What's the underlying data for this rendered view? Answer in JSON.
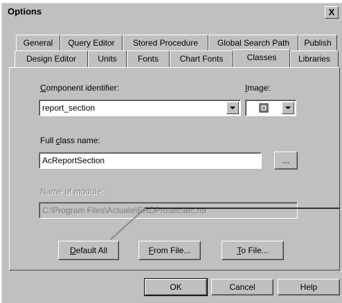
{
  "window": {
    "title": "Options",
    "close_label": "X"
  },
  "tabs_row1": [
    "General",
    "Query Editor",
    "Stored Procedure",
    "Global Search Path",
    "Publish"
  ],
  "tabs_row2": [
    "Design Editor",
    "Units",
    "Fonts",
    "Chart Fonts",
    "Classes",
    "Libraries"
  ],
  "active_tab": "Classes",
  "form": {
    "component_identifier": {
      "label_prefix": "C",
      "label_rest": "omponent identifier:",
      "value": "report_section"
    },
    "image": {
      "label_prefix": "I",
      "label_rest": "mage:",
      "icon": "section-image-icon"
    },
    "full_class_name": {
      "label_prefix": "Full ",
      "label_accel": "c",
      "label_rest": "lass name:",
      "value": "AcReportSection",
      "browse_label": "..."
    },
    "module": {
      "label": "Name of module:",
      "value": "C:\\Program Files\\Actuate\\ERDPro\\afc\\afc.rol"
    }
  },
  "action_buttons": {
    "default_all": {
      "accel": "D",
      "rest": "efault All"
    },
    "from_file": {
      "accel": "F",
      "rest": "rom File..."
    },
    "to_file": {
      "accel": "T",
      "rest": "o File..."
    }
  },
  "dialog_buttons": {
    "ok": "OK",
    "cancel": "Cancel",
    "help": "Help"
  }
}
